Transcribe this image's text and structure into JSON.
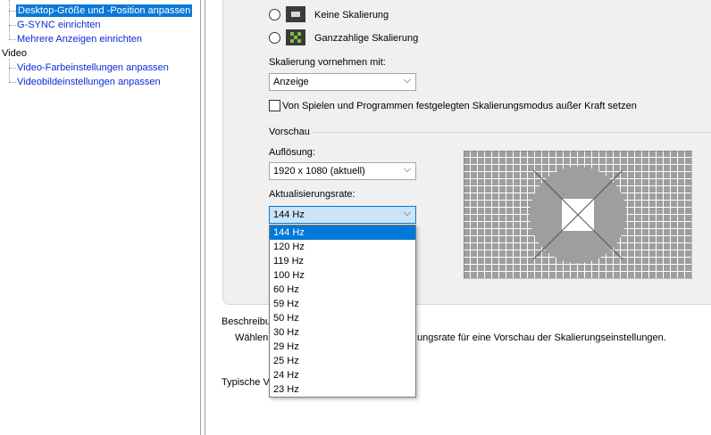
{
  "tree": {
    "items": [
      {
        "label": "Desktop-Größe und -Position anpassen",
        "selected": true
      },
      {
        "label": "G-SYNC einrichten",
        "selected": false
      },
      {
        "label": "Mehrere Anzeigen einrichten",
        "selected": false
      }
    ],
    "category": "Video",
    "video_items": [
      {
        "label": "Video-Farbeinstellungen anpassen"
      },
      {
        "label": "Videobildeinstellungen anpassen"
      }
    ]
  },
  "scaling": {
    "option_none": "Keine Skalierung",
    "option_integer": "Ganzzahlige Skalierung",
    "perform_label": "Skalierung vornehmen mit:",
    "perform_value": "Anzeige",
    "override_label": "Von Spielen und Programmen festgelegten Skalierungsmodus außer Kraft setzen"
  },
  "preview": {
    "group_label": "Vorschau",
    "resolution_label": "Auflösung:",
    "resolution_value": "1920 x 1080 (aktuell)",
    "refresh_label": "Aktualisierungsrate:",
    "refresh_value": "144 Hz",
    "refresh_options": [
      "144 Hz",
      "120 Hz",
      "119 Hz",
      "100 Hz",
      "60 Hz",
      "59 Hz",
      "50 Hz",
      "30 Hz",
      "29 Hz",
      "25 Hz",
      "24 Hz",
      "23 Hz"
    ]
  },
  "description": {
    "label": "Beschreibu",
    "text_left": "Wählen",
    "text_right": "ungsrate für eine Vorschau der Skalierungseinstellungen."
  },
  "typical": {
    "label": "Typische V"
  },
  "colors": {
    "selection": "#0078d7",
    "link": "#0a2ad8"
  }
}
